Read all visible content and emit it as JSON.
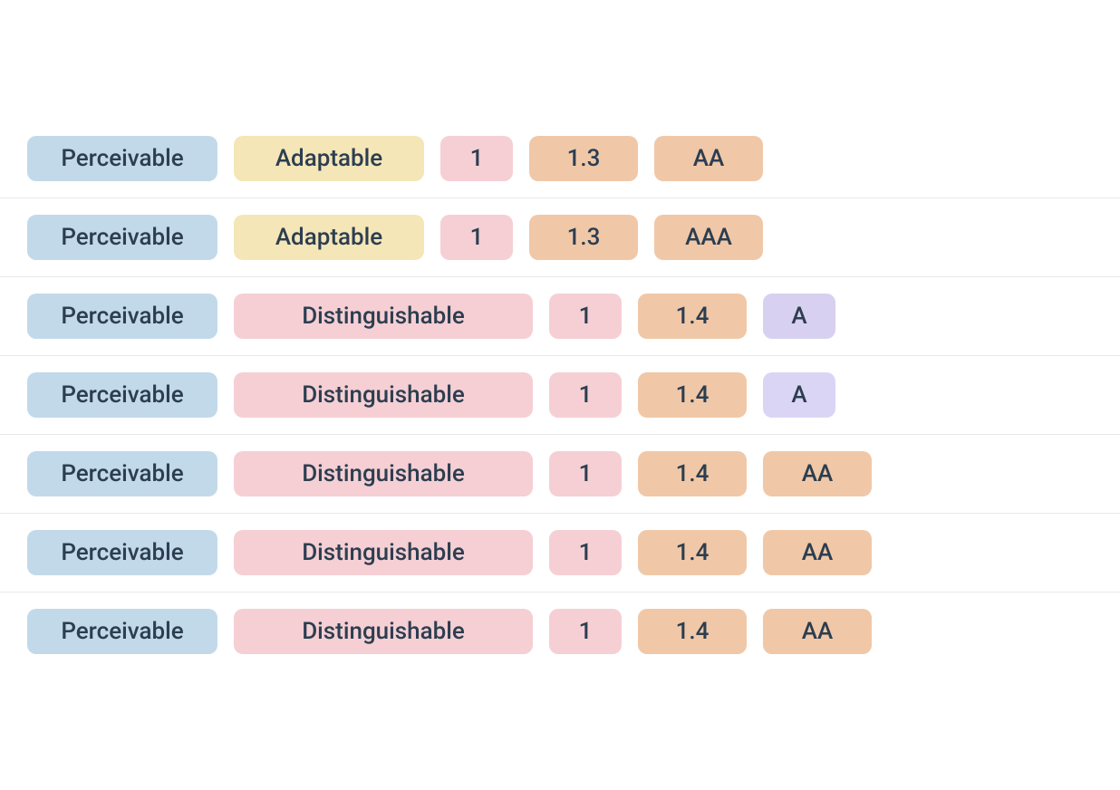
{
  "rows": [
    {
      "id": "row-1",
      "principle": "Perceivable",
      "guideline": "Adaptable",
      "number": "1",
      "version": "1.3",
      "level": "AA",
      "guideline_color": "yellow",
      "number_color": "pink-small",
      "version_color": "peach",
      "level_color": "peach-aa"
    },
    {
      "id": "row-2",
      "principle": "Perceivable",
      "guideline": "Adaptable",
      "number": "1",
      "version": "1.3",
      "level": "AAA",
      "guideline_color": "yellow",
      "number_color": "pink-small",
      "version_color": "peach",
      "level_color": "peach-aa"
    },
    {
      "id": "row-3",
      "principle": "Perceivable",
      "guideline": "Distinguishable",
      "number": "1",
      "version": "1.4",
      "level": "A",
      "guideline_color": "pink",
      "number_color": "pink-small",
      "version_color": "peach",
      "level_color": "purple"
    },
    {
      "id": "row-4",
      "principle": "Perceivable",
      "guideline": "Distinguishable",
      "number": "1",
      "version": "1.4",
      "level": "A",
      "guideline_color": "pink",
      "number_color": "pink-small",
      "version_color": "peach",
      "level_color": "lavender"
    },
    {
      "id": "row-5",
      "principle": "Perceivable",
      "guideline": "Distinguishable",
      "number": "1",
      "version": "1.4",
      "level": "AA",
      "guideline_color": "pink",
      "number_color": "pink-small",
      "version_color": "peach",
      "level_color": "peach-aa"
    },
    {
      "id": "row-6",
      "principle": "Perceivable",
      "guideline": "Distinguishable",
      "number": "1",
      "version": "1.4",
      "level": "AA",
      "guideline_color": "pink",
      "number_color": "pink-small",
      "version_color": "peach",
      "level_color": "peach-aa"
    },
    {
      "id": "row-7",
      "principle": "Perceivable",
      "guideline": "Distinguishable",
      "number": "1",
      "version": "1.4",
      "level": "AA",
      "guideline_color": "pink",
      "number_color": "pink-small",
      "version_color": "peach",
      "level_color": "peach-aa"
    }
  ]
}
